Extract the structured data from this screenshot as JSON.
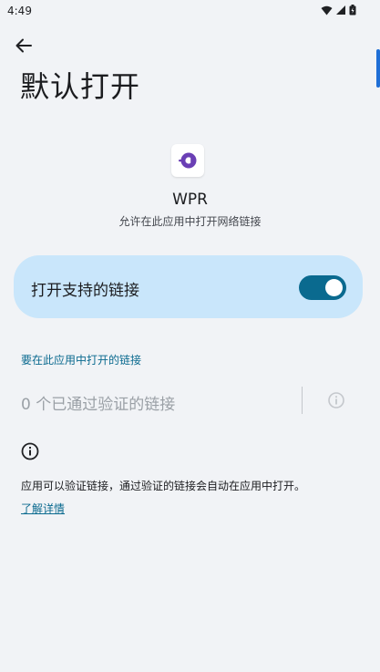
{
  "status_bar": {
    "time": "4:49"
  },
  "header": {
    "title": "默认打开"
  },
  "app": {
    "name": "WPR",
    "description": "允许在此应用中打开网络链接"
  },
  "toggle": {
    "label": "打开支持的链接",
    "enabled": true
  },
  "links_section": {
    "header": "要在此应用中打开的链接",
    "verified_count_text": "0 个已通过验证的链接"
  },
  "info": {
    "text": "应用可以验证链接，通过验证的链接会自动在应用中打开。",
    "learn_more": "了解详情"
  },
  "colors": {
    "accent": "#0a6a8f",
    "toggle_card_bg": "#c9e6fb",
    "app_icon": "#6a3fb5"
  }
}
